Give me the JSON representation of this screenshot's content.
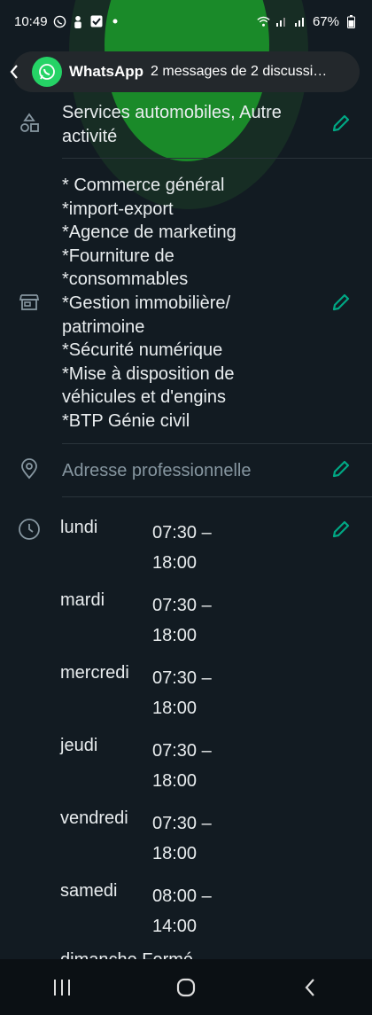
{
  "status_bar": {
    "time": "10:49",
    "battery": "67%"
  },
  "notification": {
    "app": "WhatsApp",
    "message": "2 messages de 2 discussi…"
  },
  "category": {
    "text": "Services automobiles, Autre activité"
  },
  "description": {
    "lines": [
      "* Commerce général",
      "*import-export",
      "*Agence de marketing",
      "*Fourniture de",
      "*consommables",
      "*Gestion immobilière/",
      "patrimoine",
      "*Sécurité numérique",
      "*Mise à disposition de",
      "véhicules et d'engins",
      "*BTP Génie civil"
    ]
  },
  "address": {
    "placeholder": "Adresse professionnelle"
  },
  "hours": [
    {
      "day": "lundi",
      "time": "07:30 – 18:00"
    },
    {
      "day": "mardi",
      "time": "07:30 – 18:00"
    },
    {
      "day": "mercredi",
      "time": "07:30 – 18:00"
    },
    {
      "day": "jeudi",
      "time": "07:30 – 18:00"
    },
    {
      "day": "vendredi",
      "time": "07:30 – 18:00"
    },
    {
      "day": "samedi",
      "time": "08:00 – 14:00"
    }
  ],
  "partial_row": {
    "text": "dimanche  Fermé"
  },
  "colors": {
    "background": "#121b22",
    "accent": "#25d366",
    "edit": "#00a884"
  }
}
